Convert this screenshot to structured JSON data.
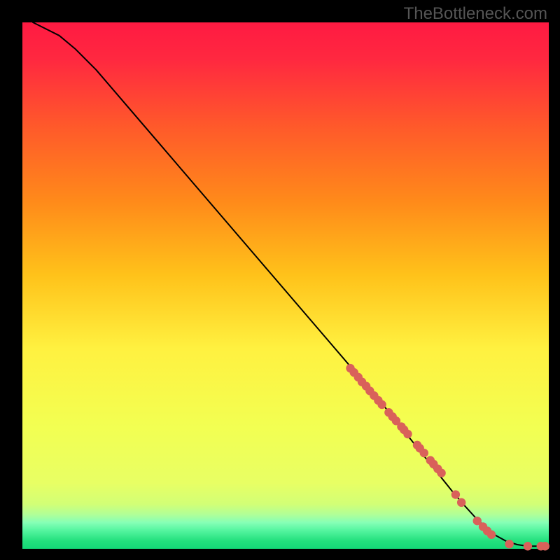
{
  "watermark": "TheBottleneck.com",
  "chart_data": {
    "type": "line",
    "title": "",
    "xlabel": "",
    "ylabel": "",
    "xlim": [
      0,
      100
    ],
    "ylim": [
      0,
      100
    ],
    "axes_shown": false,
    "colors": {
      "line": "#000000",
      "marker_fill": "#d9615a",
      "marker_stroke": "#d9615a",
      "background_top": "#ff1744",
      "background_mid_upper": "#ff8a00",
      "background_mid": "#ffff44",
      "background_lower": "#e6ff5c",
      "background_strip1": "#c7ff7a",
      "background_strip2": "#7bffbb",
      "background_strip3": "#35ec83",
      "background_bottom": "#15e079"
    },
    "curve": {
      "x": [
        2,
        4,
        7,
        10,
        14,
        20,
        26,
        32,
        38,
        44,
        50,
        56,
        62,
        68,
        72,
        76,
        80,
        82,
        84,
        86,
        88,
        90,
        92,
        94,
        96,
        98,
        100
      ],
      "y": [
        100,
        99,
        97.5,
        95,
        91,
        84,
        77,
        70,
        63,
        56,
        49,
        42,
        35,
        28,
        23,
        18,
        13,
        10.5,
        8.2,
        6,
        4,
        2.5,
        1.4,
        0.8,
        0.5,
        0.5,
        0.5
      ]
    },
    "highlight_points": {
      "x": [
        62.3,
        63.0,
        63.8,
        64.5,
        65.3,
        66.0,
        66.8,
        67.6,
        68.3,
        69.6,
        70.3,
        71.0,
        72.0,
        72.5,
        73.2,
        75.0,
        75.5,
        76.3,
        77.5,
        78.1,
        78.9,
        79.6,
        82.3,
        83.4,
        86.4,
        87.5,
        88.3,
        89.1,
        92.5,
        96.0,
        98.5,
        99.3
      ],
      "y": [
        34.3,
        33.5,
        32.6,
        31.7,
        30.9,
        30.0,
        29.1,
        28.2,
        27.4,
        25.9,
        25.1,
        24.3,
        23.2,
        22.6,
        21.8,
        19.7,
        19.1,
        18.2,
        16.8,
        16.1,
        15.2,
        14.4,
        10.3,
        8.8,
        5.3,
        4.2,
        3.4,
        2.7,
        0.9,
        0.5,
        0.5,
        0.5
      ]
    }
  }
}
